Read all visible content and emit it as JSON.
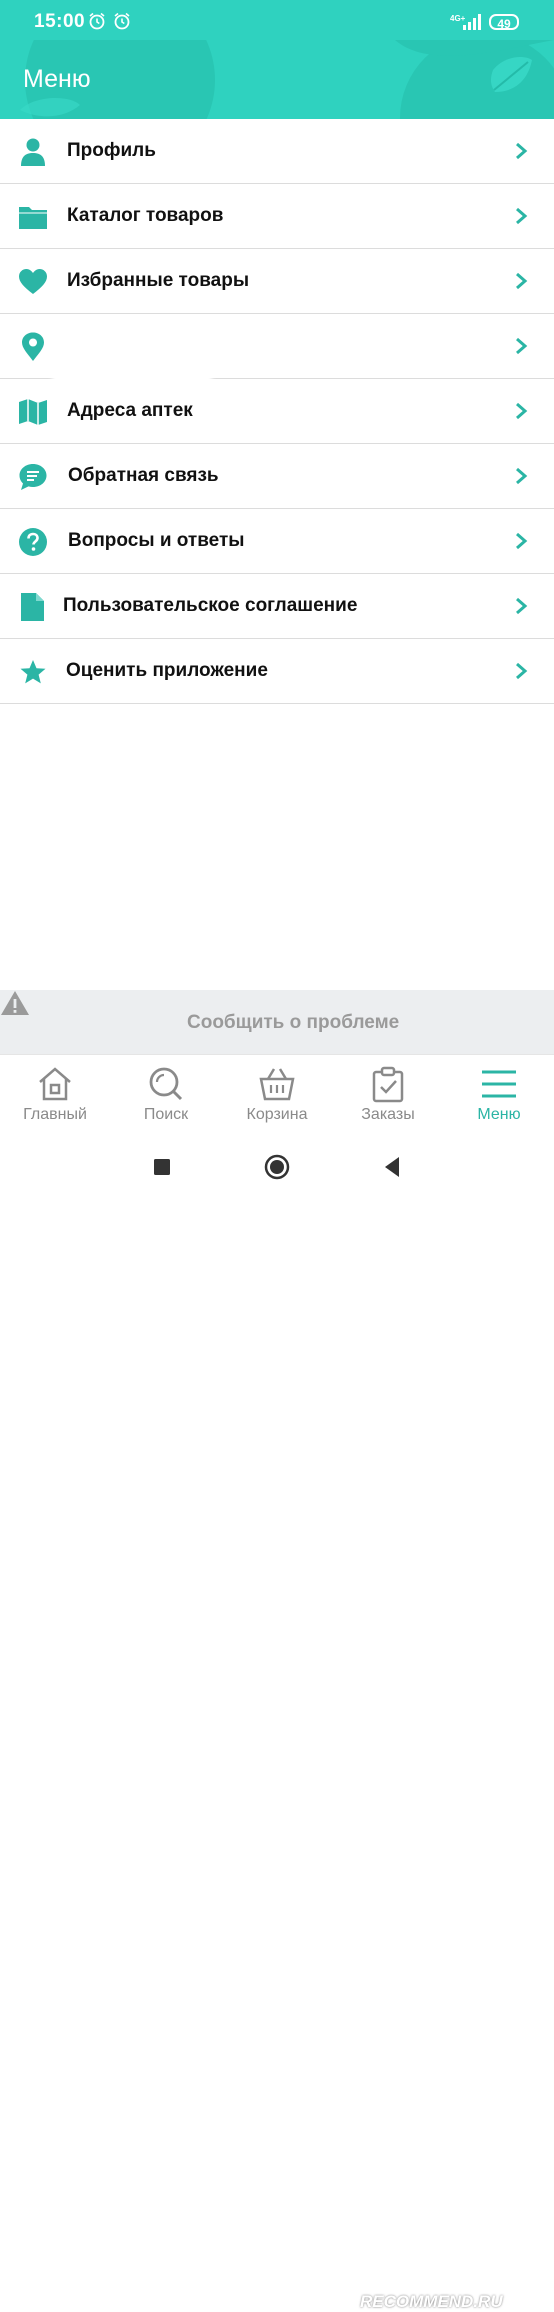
{
  "status_bar": {
    "time": "15:00",
    "network": "4G+",
    "battery": "49"
  },
  "header": {
    "title": "Меню"
  },
  "menu": [
    {
      "label": "Профиль",
      "icon": "person-icon"
    },
    {
      "label": "Каталог товаров",
      "icon": "folder-icon"
    },
    {
      "label": "Избранные товары",
      "icon": "heart-icon"
    },
    {
      "label": "",
      "icon": "location-pin-icon"
    },
    {
      "label": "Адреса аптек",
      "icon": "map-icon"
    },
    {
      "label": "Обратная связь",
      "icon": "chat-icon"
    },
    {
      "label": "Вопросы и ответы",
      "icon": "question-icon"
    },
    {
      "label": "Пользовательское соглашение",
      "icon": "document-icon"
    },
    {
      "label": "Оценить приложение",
      "icon": "star-icon"
    }
  ],
  "report": {
    "label": "Сообщить о проблеме"
  },
  "tabs": [
    {
      "label": "Главный",
      "icon": "home-icon"
    },
    {
      "label": "Поиск",
      "icon": "search-icon"
    },
    {
      "label": "Корзина",
      "icon": "basket-icon"
    },
    {
      "label": "Заказы",
      "icon": "orders-icon"
    },
    {
      "label": "Меню",
      "icon": "menu-icon",
      "active": true
    }
  ],
  "watermark": "RECOMMEND.RU",
  "colors": {
    "accent": "#2fd2bf",
    "icon": "#2bb5a5",
    "inactive": "#8a8a8a"
  }
}
